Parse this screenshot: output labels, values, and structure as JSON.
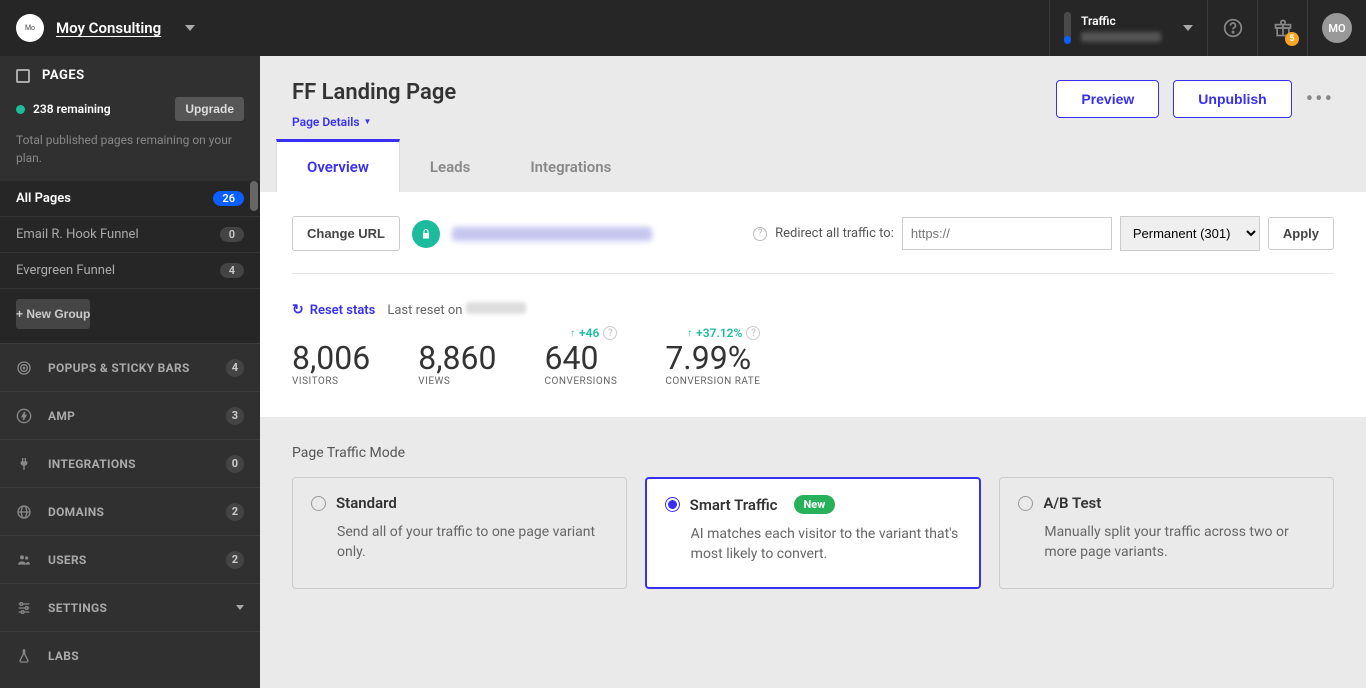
{
  "topbar": {
    "company": "Moy Consulting",
    "traffic_label": "Traffic",
    "gift_count": "5",
    "avatar": "MO"
  },
  "sidebar": {
    "pages_header": "PAGES",
    "remaining": "238 remaining",
    "upgrade": "Upgrade",
    "remaining_desc": "Total published pages remaining on your plan.",
    "items": [
      {
        "label": "All Pages",
        "count": "26",
        "active": true
      },
      {
        "label": "Email R. Hook Funnel",
        "count": "0"
      },
      {
        "label": "Evergreen Funnel",
        "count": "4"
      }
    ],
    "new_group": "+ New Group",
    "nav": [
      {
        "label": "POPUPS & STICKY BARS",
        "badge": "4"
      },
      {
        "label": "AMP",
        "badge": "3"
      },
      {
        "label": "INTEGRATIONS",
        "badge": "0"
      },
      {
        "label": "DOMAINS",
        "badge": "2"
      },
      {
        "label": "USERS",
        "badge": "2"
      },
      {
        "label": "SETTINGS",
        "caret": true
      },
      {
        "label": "LABS"
      }
    ]
  },
  "header": {
    "title": "FF Landing Page",
    "details": "Page Details",
    "preview": "Preview",
    "unpublish": "Unpublish"
  },
  "tabs": [
    "Overview",
    "Leads",
    "Integrations"
  ],
  "url_row": {
    "change_url": "Change URL",
    "redirect_label": "Redirect all traffic to:",
    "redirect_placeholder": "https://",
    "redirect_type": "Permanent (301)",
    "apply": "Apply"
  },
  "reset": {
    "link": "Reset stats",
    "prefix": "Last reset on"
  },
  "stats": {
    "visitors": {
      "value": "8,006",
      "label": "VISITORS"
    },
    "views": {
      "value": "8,860",
      "label": "VIEWS"
    },
    "conversions": {
      "value": "640",
      "label": "CONVERSIONS",
      "delta": "+46"
    },
    "rate": {
      "value": "7.99%",
      "label": "CONVERSION RATE",
      "delta": "+37.12%"
    }
  },
  "traffic_mode": {
    "title": "Page Traffic Mode",
    "standard": {
      "name": "Standard",
      "desc": "Send all of your traffic to one page variant only."
    },
    "smart": {
      "name": "Smart Traffic",
      "badge": "New",
      "desc": "AI matches each visitor to the variant that's most likely to convert."
    },
    "ab": {
      "name": "A/B Test",
      "desc": "Manually split your traffic across two or more page variants."
    }
  }
}
